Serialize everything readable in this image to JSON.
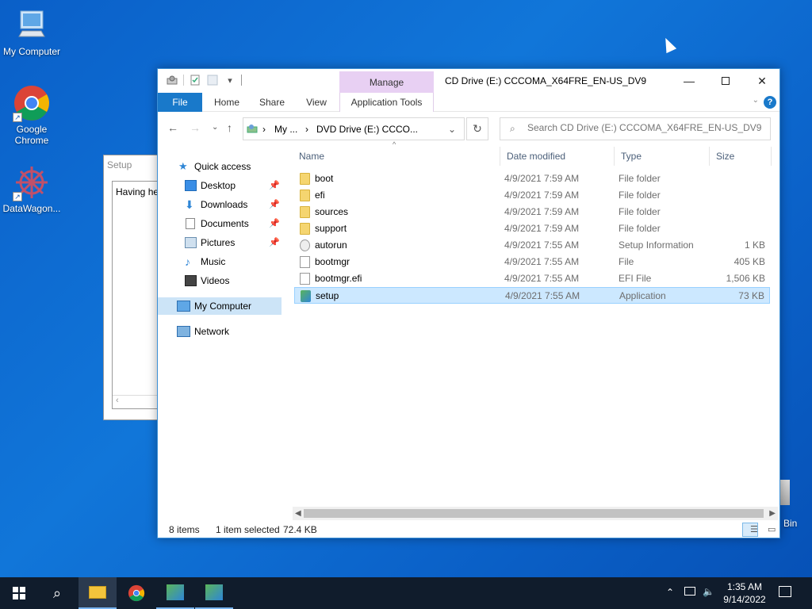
{
  "desktop": {
    "icons": [
      {
        "label": "My Computer",
        "icon": "monitor-icon"
      },
      {
        "label": "Google Chrome",
        "icon": "chrome-icon"
      },
      {
        "label": "DataWagon...",
        "icon": "datawagon-icon"
      }
    ],
    "recycle_bin_label": "Bin"
  },
  "bg_window": {
    "title": "Setup",
    "text": "Having help"
  },
  "explorer": {
    "title": "CD Drive (E:) CCCOMA_X64FRE_EN-US_DV9",
    "context_tab": "Manage",
    "ribbon_tabs": [
      "File",
      "Home",
      "Share",
      "View",
      "Application Tools"
    ],
    "address": {
      "seg1": "My ...",
      "seg2": "DVD Drive (E:) CCCO..."
    },
    "search_placeholder": "Search CD Drive (E:) CCCOMA_X64FRE_EN-US_DV9",
    "nav": [
      {
        "label": "Quick access",
        "icon": "star-icon",
        "pinned": false
      },
      {
        "label": "Desktop",
        "icon": "desktop-icon",
        "pinned": true
      },
      {
        "label": "Downloads",
        "icon": "download-icon",
        "pinned": true
      },
      {
        "label": "Documents",
        "icon": "document-icon",
        "pinned": true
      },
      {
        "label": "Pictures",
        "icon": "picture-icon",
        "pinned": true
      },
      {
        "label": "Music",
        "icon": "music-icon",
        "pinned": false
      },
      {
        "label": "Videos",
        "icon": "video-icon",
        "pinned": false
      },
      {
        "label": "My Computer",
        "icon": "computer-icon",
        "pinned": false
      },
      {
        "label": "Network",
        "icon": "network-icon",
        "pinned": false
      }
    ],
    "columns": [
      "Name",
      "Date modified",
      "Type",
      "Size"
    ],
    "files": [
      {
        "name": "boot",
        "date": "4/9/2021 7:59 AM",
        "type": "File folder",
        "size": "",
        "kind": "folder"
      },
      {
        "name": "efi",
        "date": "4/9/2021 7:59 AM",
        "type": "File folder",
        "size": "",
        "kind": "folder"
      },
      {
        "name": "sources",
        "date": "4/9/2021 7:59 AM",
        "type": "File folder",
        "size": "",
        "kind": "folder"
      },
      {
        "name": "support",
        "date": "4/9/2021 7:59 AM",
        "type": "File folder",
        "size": "",
        "kind": "folder"
      },
      {
        "name": "autorun",
        "date": "4/9/2021 7:55 AM",
        "type": "Setup Information",
        "size": "1 KB",
        "kind": "inf"
      },
      {
        "name": "bootmgr",
        "date": "4/9/2021 7:55 AM",
        "type": "File",
        "size": "405 KB",
        "kind": "file"
      },
      {
        "name": "bootmgr.efi",
        "date": "4/9/2021 7:55 AM",
        "type": "EFI File",
        "size": "1,506 KB",
        "kind": "file"
      },
      {
        "name": "setup",
        "date": "4/9/2021 7:55 AM",
        "type": "Application",
        "size": "73 KB",
        "kind": "app",
        "selected": true
      }
    ],
    "status": {
      "items": "8 items",
      "selected": "1 item selected",
      "size": "72.4 KB"
    }
  },
  "taskbar": {
    "time": "1:35 AM",
    "date": "9/14/2022"
  }
}
